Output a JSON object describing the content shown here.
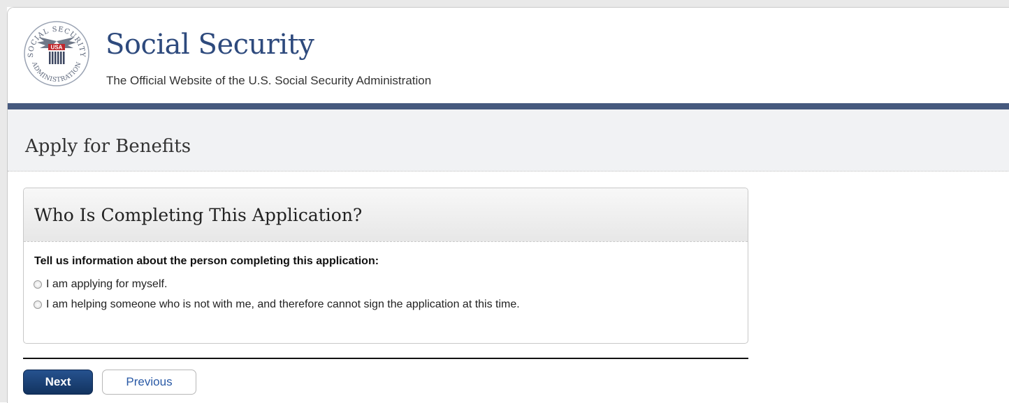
{
  "header": {
    "site_title": "Social Security",
    "site_subtitle": "The Official Website of the U.S. Social Security Administration",
    "logo": {
      "top_text": "SOCIAL SECURITY",
      "bottom_text": "ADMINISTRATION",
      "shield_text": "USA"
    }
  },
  "page": {
    "title": "Apply for Benefits"
  },
  "question": {
    "heading": "Who Is Completing This Application?",
    "prompt": "Tell us information about the person completing this application:",
    "options": [
      {
        "label": "I am applying for myself.",
        "selected": false
      },
      {
        "label": "I am helping someone who is not with me, and therefore cannot sign the application at this time.",
        "selected": false
      }
    ]
  },
  "actions": {
    "next_label": "Next",
    "previous_label": "Previous"
  },
  "colors": {
    "brand_blue": "#2e4a7d",
    "header_bar": "#46597e",
    "next_button": "#1c3f73",
    "link_blue": "#2a5aa6"
  }
}
